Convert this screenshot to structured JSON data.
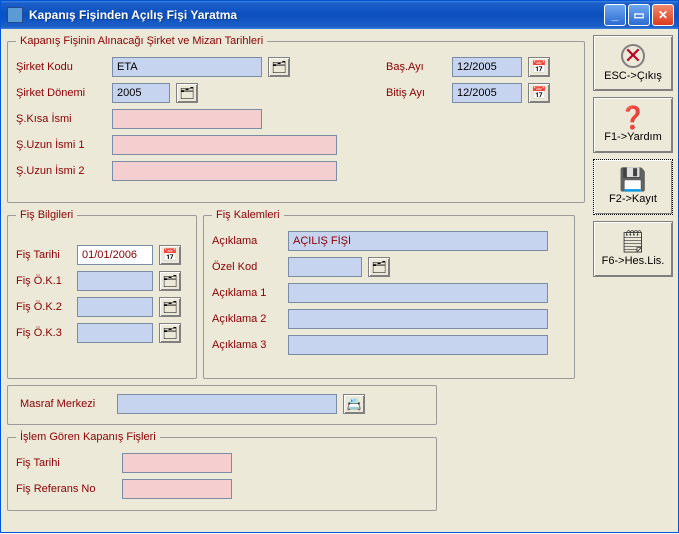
{
  "window": {
    "title": "Kapanış Fişinden Açılış Fişi Yaratma"
  },
  "group_kapanis": {
    "legend": "Kapanış Fişinin Alınacağı Şirket ve Mizan Tarihleri",
    "sirket_kodu_label": "Şirket Kodu",
    "sirket_kodu": "ETA",
    "sirket_donemi_label": "Şirket Dönemi",
    "sirket_donemi": "2005",
    "s_kisa_ismi_label": "Ş.Kısa İsmi",
    "s_kisa_ismi": "",
    "s_uzun_ismi1_label": "Ş.Uzun İsmi 1",
    "s_uzun_ismi1": "",
    "s_uzun_ismi2_label": "Ş.Uzun İsmi 2",
    "s_uzun_ismi2": "",
    "bas_ayi_label": "Baş.Ayı",
    "bas_ayi": "12/2005",
    "bitis_ayi_label": "Bitiş Ayı",
    "bitis_ayi": "12/2005"
  },
  "group_fis_bilgileri": {
    "legend": "Fiş Bilgileri",
    "fis_tarihi_label": "Fiş Tarihi",
    "fis_tarihi": "01/01/2006",
    "fis_ok1_label": "Fiş Ö.K.1",
    "fis_ok1": "",
    "fis_ok2_label": "Fiş Ö.K.2",
    "fis_ok2": "",
    "fis_ok3_label": "Fiş Ö.K.3",
    "fis_ok3": ""
  },
  "group_fis_kalemleri": {
    "legend": "Fiş Kalemleri",
    "aciklama_label": "Açıklama",
    "aciklama": "AÇILIŞ FİŞİ",
    "ozel_kod_label": "Özel Kod",
    "ozel_kod": "",
    "aciklama1_label": "Açıklama 1",
    "aciklama1": "",
    "aciklama2_label": "Açıklama 2",
    "aciklama2": "",
    "aciklama3_label": "Açıklama 3",
    "aciklama3": ""
  },
  "group_masraf": {
    "masraf_merkezi_label": "Masraf Merkezi",
    "masraf_merkezi": ""
  },
  "group_islem": {
    "legend": "İşlem Gören Kapanış Fişleri",
    "fis_tarihi_label": "Fiş Tarihi",
    "fis_tarihi": "",
    "fis_referans_no_label": "Fiş Referans No",
    "fis_referans_no": ""
  },
  "buttons": {
    "esc_label": "ESC->Çıkış",
    "f1_label": "F1->Yardım",
    "f2_label": "F2->Kayıt",
    "f6_label": "F6->Hes.Lis."
  }
}
